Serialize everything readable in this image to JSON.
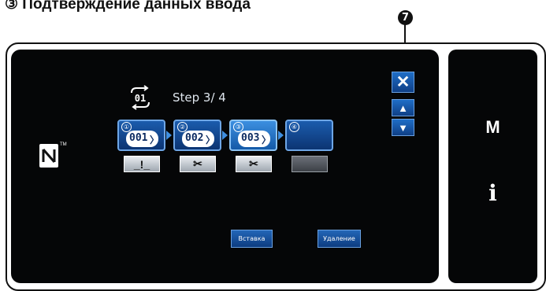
{
  "heading": "③ Подтверждение данных ввода",
  "callout": "7",
  "screen": {
    "step_label": "Step  3/ 4",
    "program_icon": "program-loop-icon",
    "nfc_icon": "nfc-icon",
    "controls": {
      "close_label": "✕",
      "up_label": "▲",
      "down_label": "▼"
    },
    "steps": [
      {
        "number": "①",
        "code": "001",
        "selected": false,
        "sub_icon": "thread-trim-off-icon",
        "sub_glyph": "_!_"
      },
      {
        "number": "②",
        "code": "002",
        "selected": false,
        "sub_icon": "scissors-icon",
        "sub_glyph": "✂"
      },
      {
        "number": "③",
        "code": "003",
        "selected": true,
        "sub_icon": "scissors-icon",
        "sub_glyph": "✂"
      },
      {
        "number": "④",
        "code": "",
        "selected": false,
        "sub_icon": "",
        "sub_glyph": ""
      }
    ],
    "insert_label": "Вставка",
    "delete_label": "Удаление"
  },
  "side_panel": {
    "m_label": "M",
    "i_label": "i"
  },
  "colors": {
    "screen_bg": "#050607",
    "accent": "#1f6ec7",
    "selected_card": "#3c8fe0"
  }
}
